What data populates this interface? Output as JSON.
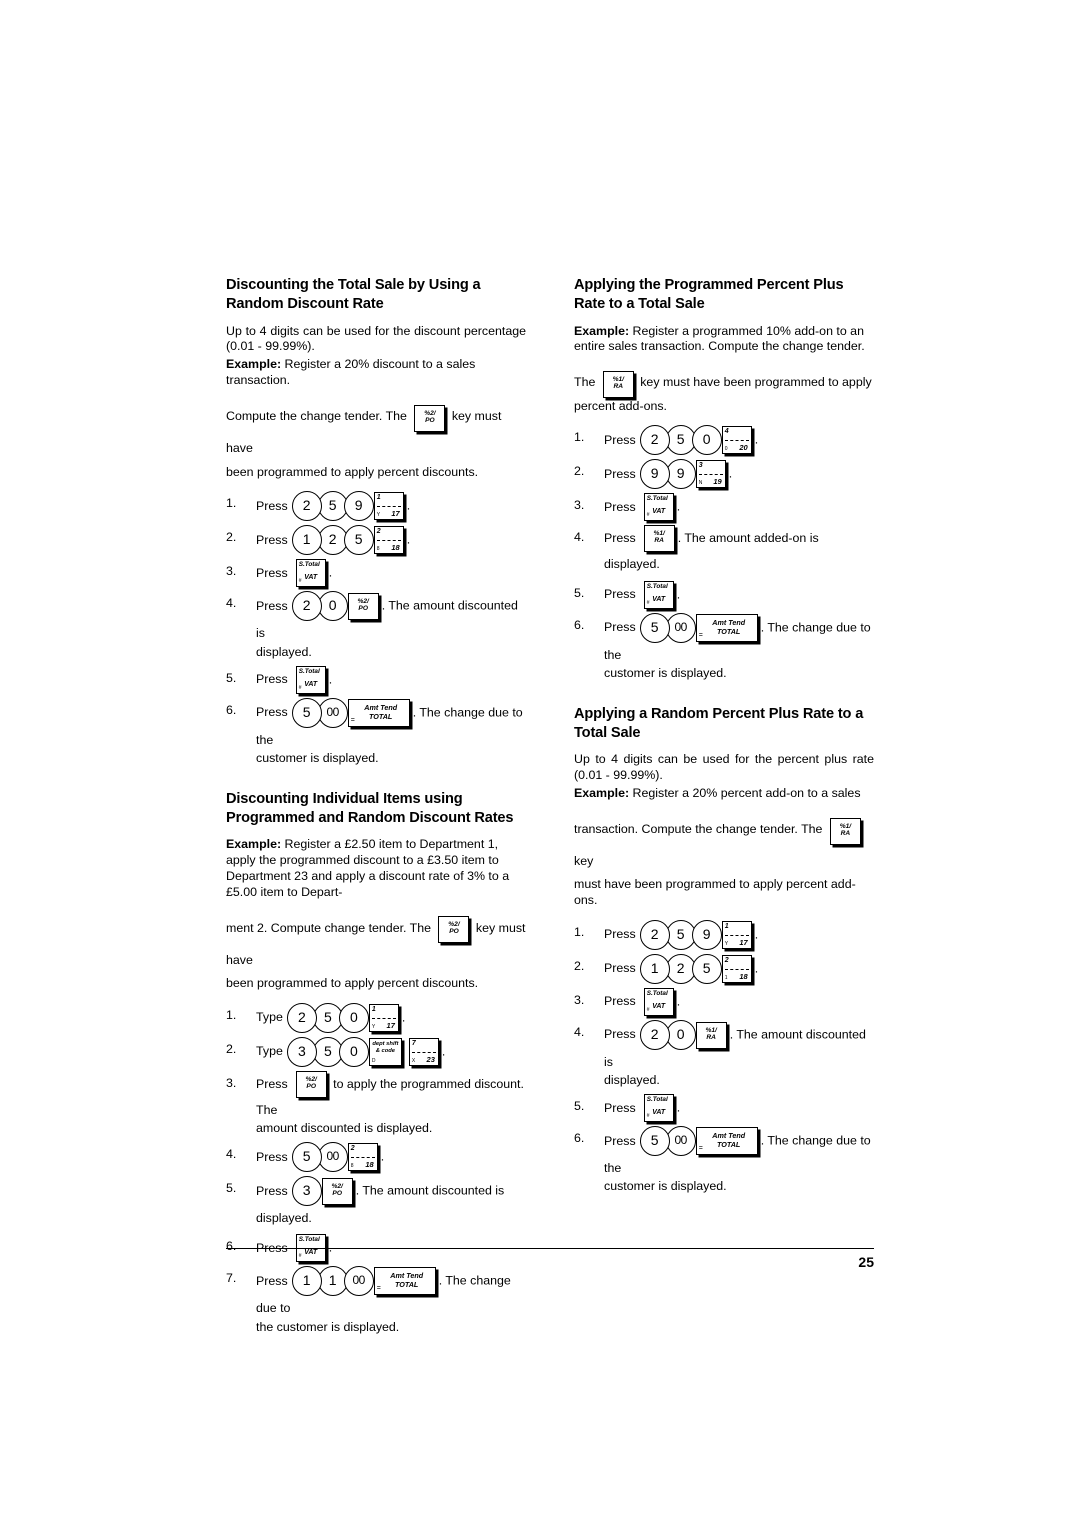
{
  "page": {
    "number": "25"
  },
  "keys": {
    "pct2_po": {
      "line1": "%2/",
      "line2": "PO"
    },
    "pct1_ra": {
      "line1": "%1/",
      "line2": "RA"
    },
    "stotal": {
      "line1": "S.Total",
      "line2": "VAT",
      "mark": "#"
    },
    "total": {
      "line1": "Amt Tend",
      "line2": "TOTAL",
      "mark": "="
    },
    "dept_shift": {
      "line1": "dept shift",
      "line2": "& code",
      "mark": "D"
    }
  },
  "sections": [
    {
      "id": "random-discount-rate",
      "column": "left",
      "heading": "Discounting the Total Sale by Using a Random Discount Rate",
      "intro_1": "Up to 4 digits can be used for the discount percentage (0.01 - 99.99%).",
      "example_label": "Example:",
      "example_text": "Register a 20% discount to a sales transaction.",
      "pre_key_text": "Compute the change tender. The",
      "post_key_text": "key must have",
      "after_key_line": "been programmed to apply percent discounts.",
      "steps": [
        {
          "num": "1.",
          "verb": "Press",
          "digits": [
            "2",
            "5",
            "9"
          ],
          "dept": {
            "top": "1",
            "bottom": "17",
            "mark": "Y"
          },
          "tail": "."
        },
        {
          "num": "2.",
          "verb": "Press",
          "digits": [
            "1",
            "2",
            "5"
          ],
          "dept": {
            "top": "2",
            "bottom": "18",
            "mark": "8"
          },
          "tail": "."
        },
        {
          "num": "3.",
          "verb": "Press",
          "func": "stotal",
          "tail": "."
        },
        {
          "num": "4.",
          "verb": "Press",
          "digits": [
            "2",
            "0"
          ],
          "func": "pct2_po",
          "tail": ". The amount discounted is",
          "cont": "displayed."
        },
        {
          "num": "5.",
          "verb": "Press",
          "func": "stotal",
          "tail": "."
        },
        {
          "num": "6.",
          "verb": "Press",
          "digits": [
            "5",
            "00"
          ],
          "func": "total",
          "tail": ". The change due to the",
          "cont": "customer is displayed."
        }
      ]
    },
    {
      "id": "individual-items-discount",
      "column": "left",
      "heading": "Discounting Individual Items using Programmed and Random Discount Rates",
      "example_label": "Example:",
      "example_text": "Register a £2.50 item to Department 1, apply the programmed discount to a £3.50 item to Department 23 and apply a discount rate of 3% to a £5.00 item to Depart-",
      "pre_key_text": "ment 2. Compute change tender. The",
      "post_key_text": "key must have",
      "after_key_line": "been programmed to apply percent discounts.",
      "steps": [
        {
          "num": "1.",
          "verb": "Type",
          "digits": [
            "2",
            "5",
            "0"
          ],
          "dept": {
            "top": "1",
            "bottom": "17",
            "mark": "Y"
          },
          "tail": "."
        },
        {
          "num": "2.",
          "verb": "Type",
          "digits": [
            "3",
            "5",
            "0"
          ],
          "func": "dept_shift",
          "dept": {
            "top": "7",
            "bottom": "23",
            "mark": "X"
          },
          "tail": "."
        },
        {
          "num": "3.",
          "verb": "Press",
          "func": "pct2_po",
          "tail": "to apply the programmed discount. The",
          "cont": "amount discounted is displayed."
        },
        {
          "num": "4.",
          "verb": "Press",
          "digits": [
            "5",
            "00"
          ],
          "dept": {
            "top": "2",
            "bottom": "18",
            "mark": "8"
          },
          "tail": "."
        },
        {
          "num": "5.",
          "verb": "Press",
          "digits": [
            "3"
          ],
          "func": "pct2_po",
          "tail": ". The amount discounted is displayed."
        },
        {
          "num": "6.",
          "verb": "Press",
          "func": "stotal",
          "tail": "."
        },
        {
          "num": "7.",
          "verb": "Press",
          "digits": [
            "1",
            "1",
            "00"
          ],
          "func": "total",
          "tail": ". The change due to",
          "cont": "the customer is displayed."
        }
      ]
    },
    {
      "id": "programmed-percent-plus",
      "column": "right",
      "heading": "Applying the Programmed Percent Plus Rate to a Total Sale",
      "example_label": "Example:",
      "example_text": "Register a programmed 10% add-on to an entire sales transaction. Compute the change tender.",
      "pre_key_text": "The",
      "post_key_text": "key must have been programmed to apply",
      "after_key_line": "percent add-ons.",
      "steps": [
        {
          "num": "1.",
          "verb": "Press",
          "digits": [
            "2",
            "5",
            "0"
          ],
          "dept": {
            "top": "4",
            "bottom": "20",
            "mark": "0"
          },
          "tail": "."
        },
        {
          "num": "2.",
          "verb": "Press",
          "digits": [
            "9",
            "9"
          ],
          "dept": {
            "top": "3",
            "bottom": "19",
            "mark": "N"
          },
          "tail": "."
        },
        {
          "num": "3.",
          "verb": "Press",
          "func": "stotal",
          "tail": "."
        },
        {
          "num": "4.",
          "verb": "Press",
          "func": "pct1_ra",
          "tail": ". The amount added-on is displayed."
        },
        {
          "num": "5.",
          "verb": "Press",
          "func": "stotal",
          "tail": "."
        },
        {
          "num": "6.",
          "verb": "Press",
          "digits": [
            "5",
            "00"
          ],
          "func": "total",
          "tail": ". The change due to the",
          "cont": "customer is displayed."
        }
      ]
    },
    {
      "id": "random-percent-plus",
      "column": "right",
      "heading": "Applying a Random Percent Plus Rate to a Total Sale",
      "intro_1": "Up to 4 digits can be used for the percent plus rate (0.01 - 99.99%).",
      "example_label": "Example:",
      "example_text": "Register a 20% percent add-on to a sales",
      "pre_key_text": "transaction. Compute the change tender. The",
      "post_key_text": "key",
      "after_key_line": "must have been programmed to apply percent add-ons.",
      "steps": [
        {
          "num": "1.",
          "verb": "Press",
          "digits": [
            "2",
            "5",
            "9"
          ],
          "dept": {
            "top": "1",
            "bottom": "17",
            "mark": "Y"
          },
          "tail": "."
        },
        {
          "num": "2.",
          "verb": "Press",
          "digits": [
            "1",
            "2",
            "5"
          ],
          "dept": {
            "top": "2",
            "bottom": "18",
            "mark": "1"
          },
          "tail": "."
        },
        {
          "num": "3.",
          "verb": "Press",
          "func": "stotal",
          "tail": "."
        },
        {
          "num": "4.",
          "verb": "Press",
          "digits": [
            "2",
            "0"
          ],
          "func": "pct1_ra",
          "tail": ". The amount discounted is",
          "cont": "displayed."
        },
        {
          "num": "5.",
          "verb": "Press",
          "func": "stotal",
          "tail": "."
        },
        {
          "num": "6.",
          "verb": "Press",
          "digits": [
            "5",
            "00"
          ],
          "func": "total",
          "tail": ". The change due to the",
          "cont": "customer is displayed."
        }
      ]
    }
  ]
}
